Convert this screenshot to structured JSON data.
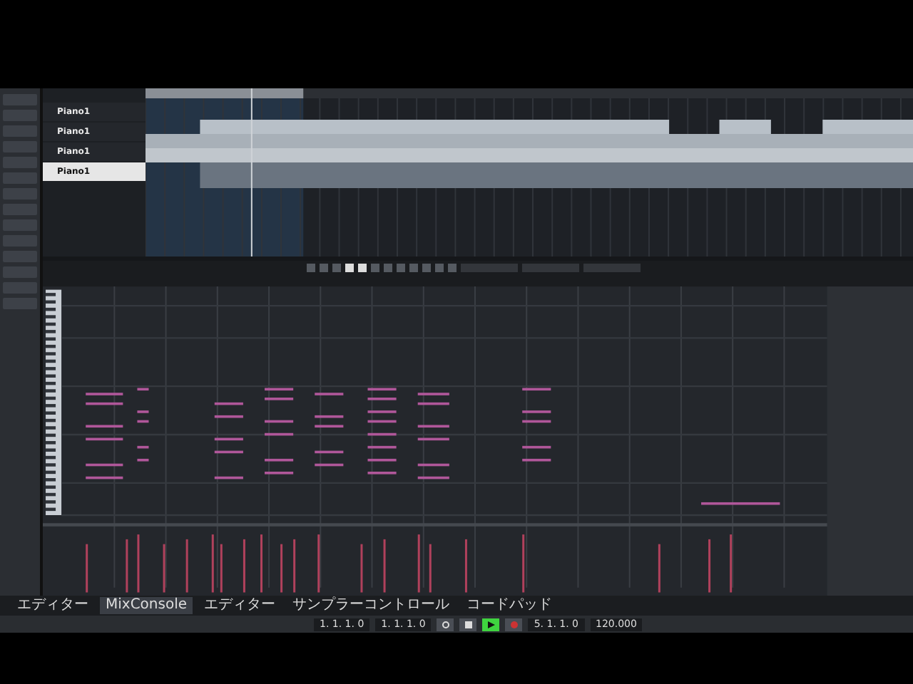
{
  "tracks": [
    {
      "name": "Piano1",
      "selected": false
    },
    {
      "name": "Piano1",
      "selected": false
    },
    {
      "name": "Piano1",
      "selected": false
    },
    {
      "name": "Piano1",
      "selected": true
    }
  ],
  "lower_tabs": [
    {
      "label": "エディター",
      "selected": false
    },
    {
      "label": "MixConsole",
      "selected": true
    },
    {
      "label": "エディター",
      "selected": false
    },
    {
      "label": "サンプラーコントロール",
      "selected": false
    },
    {
      "label": "コードパッド",
      "selected": false
    }
  ],
  "transport": {
    "left_locator": "1. 1. 1. 0",
    "right_locator": "1. 1. 1. 0",
    "position": "5. 1. 1. 0",
    "tempo": "120.000",
    "buttons": [
      {
        "kind": "cycle",
        "on": false
      },
      {
        "kind": "stop",
        "on": false
      },
      {
        "kind": "play",
        "on": true
      },
      {
        "kind": "record",
        "on": false
      }
    ]
  }
}
